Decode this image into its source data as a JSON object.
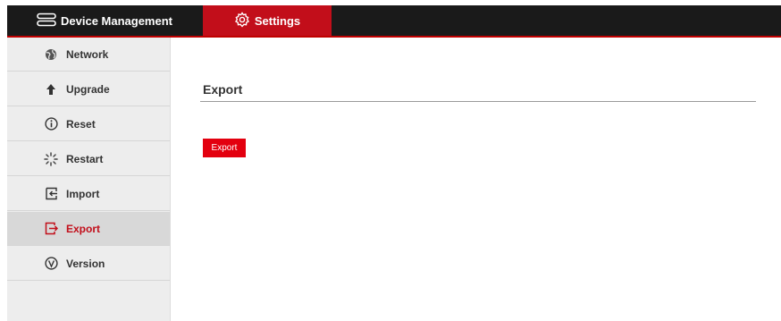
{
  "header": {
    "tabs": [
      {
        "label": "Device Management",
        "icon": "server-icon"
      },
      {
        "label": "Settings",
        "icon": "gear-icon"
      }
    ],
    "active_tab": "Settings"
  },
  "sidebar": {
    "items": [
      {
        "label": "Network",
        "icon": "globe-icon"
      },
      {
        "label": "Upgrade",
        "icon": "arrow-up-icon"
      },
      {
        "label": "Reset",
        "icon": "info-icon"
      },
      {
        "label": "Restart",
        "icon": "loading-icon"
      },
      {
        "label": "Import",
        "icon": "import-icon"
      },
      {
        "label": "Export",
        "icon": "export-icon"
      },
      {
        "label": "Version",
        "icon": "version-icon"
      }
    ],
    "active_item": "Export"
  },
  "main": {
    "title": "Export",
    "button_label": "Export"
  },
  "colors": {
    "accent": "#c20e1a",
    "button": "#e3000f",
    "header_bg": "#1a1a1a",
    "sidebar_bg": "#ededed"
  }
}
